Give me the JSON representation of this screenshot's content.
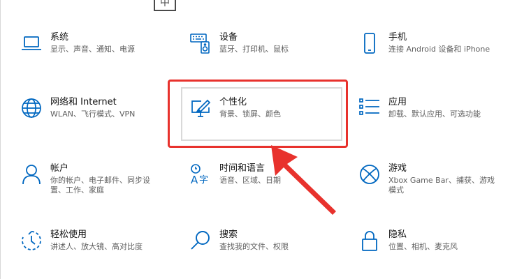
{
  "top_partial_icon": "中",
  "tiles": [
    {
      "title": "系统",
      "desc": "显示、声音、通知、电源",
      "icon": "laptop-icon"
    },
    {
      "title": "设备",
      "desc": "蓝牙、打印机、鼠标",
      "icon": "keyboard-speaker-icon"
    },
    {
      "title": "手机",
      "desc": "连接 Android 设备和 iPhone",
      "icon": "phone-icon"
    },
    {
      "title": "网络和 Internet",
      "desc": "WLAN、飞行模式、VPN",
      "icon": "globe-icon"
    },
    {
      "title": "个性化",
      "desc": "背景、锁屏、颜色",
      "icon": "paint-monitor-icon"
    },
    {
      "title": "应用",
      "desc": "卸载、默认应用、可选功能",
      "icon": "apps-list-icon"
    },
    {
      "title": "帐户",
      "desc": "你的帐户、电子邮件、同步设置、工作、家庭",
      "desc_lines": [
        "你的帐户、电子邮件、同步设",
        "置、工作、家庭"
      ],
      "icon": "person-icon"
    },
    {
      "title": "时间和语言",
      "desc": "语音、区域、日期",
      "icon": "time-language-icon"
    },
    {
      "title": "游戏",
      "desc": "Xbox Game Bar、捕获、游戏模式",
      "desc_lines": [
        "Xbox Game Bar、捕获、游戏",
        "模式"
      ],
      "icon": "xbox-icon"
    },
    {
      "title": "轻松使用",
      "desc": "讲述人、放大镜、高对比度",
      "icon": "ease-of-access-icon"
    },
    {
      "title": "搜索",
      "desc": "查找我的文件、权限",
      "icon": "search-icon"
    },
    {
      "title": "隐私",
      "desc": "位置、相机、麦克风",
      "icon": "lock-icon"
    }
  ],
  "colors": {
    "accent": "#0067c0",
    "highlight": "#e8322d",
    "title": "#111111",
    "desc": "#5f5f5f"
  }
}
